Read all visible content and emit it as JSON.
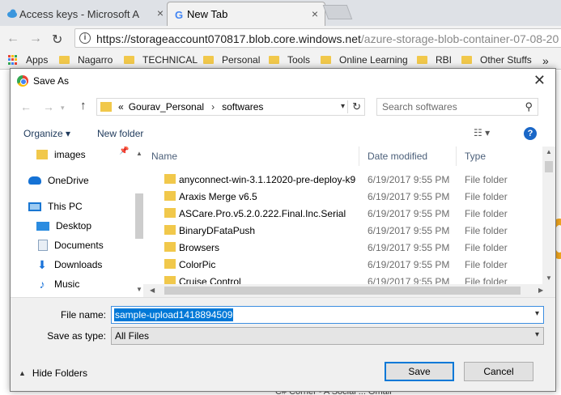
{
  "browser": {
    "tabs": [
      {
        "title": "Access keys - Microsoft A",
        "close": "×"
      },
      {
        "title": "New Tab",
        "close": "×"
      }
    ],
    "address": {
      "host": "https://storageaccount070817.blob.core.windows.net",
      "path": "/azure-storage-blob-container-07-08-20"
    },
    "bookmarks": [
      "Apps",
      "Nagarro",
      "TECHNICAL",
      "Personal",
      "Tools",
      "Online Learning",
      "RBI",
      "Other Stuffs"
    ],
    "bottom_tabs": "C# Corner - A Social ...   Gmail"
  },
  "dialog": {
    "title": "Save As",
    "close": "✕",
    "breadcrumb": {
      "prefix": "«",
      "items": [
        "Gourav_Personal",
        "softwares"
      ]
    },
    "search_placeholder": "Search softwares",
    "toolbar": {
      "organize": "Organize ▾",
      "new_folder": "New folder",
      "help": "?"
    },
    "nav_items": [
      "images",
      "OneDrive",
      "This PC",
      "Desktop",
      "Documents",
      "Downloads",
      "Music"
    ],
    "columns": {
      "name": "Name",
      "date": "Date modified",
      "type": "Type"
    },
    "files": [
      {
        "name": "anyconnect-win-3.1.12020-pre-deploy-k9",
        "date": "6/19/2017 9:55 PM",
        "type": "File folder"
      },
      {
        "name": "Araxis Merge v6.5",
        "date": "6/19/2017 9:55 PM",
        "type": "File folder"
      },
      {
        "name": "ASCare.Pro.v5.2.0.222.Final.Inc.Serial",
        "date": "6/19/2017 9:55 PM",
        "type": "File folder"
      },
      {
        "name": "BinaryDFataPush",
        "date": "6/19/2017 9:55 PM",
        "type": "File folder"
      },
      {
        "name": "Browsers",
        "date": "6/19/2017 9:55 PM",
        "type": "File folder"
      },
      {
        "name": "ColorPic",
        "date": "6/19/2017 9:55 PM",
        "type": "File folder"
      },
      {
        "name": "Cruise Control",
        "date": "6/19/2017 9:55 PM",
        "type": "File folder"
      }
    ],
    "form": {
      "file_name_label": "File name:",
      "file_name_value": "sample-upload1418894509",
      "save_as_type_label": "Save as type:",
      "save_as_type_value": "All Files",
      "hide_folders": "Hide Folders",
      "save": "Save",
      "cancel": "Cancel"
    }
  },
  "colors": {
    "folder": "#f1c84b",
    "selection": "#0078d7",
    "link": "#1e395b"
  }
}
